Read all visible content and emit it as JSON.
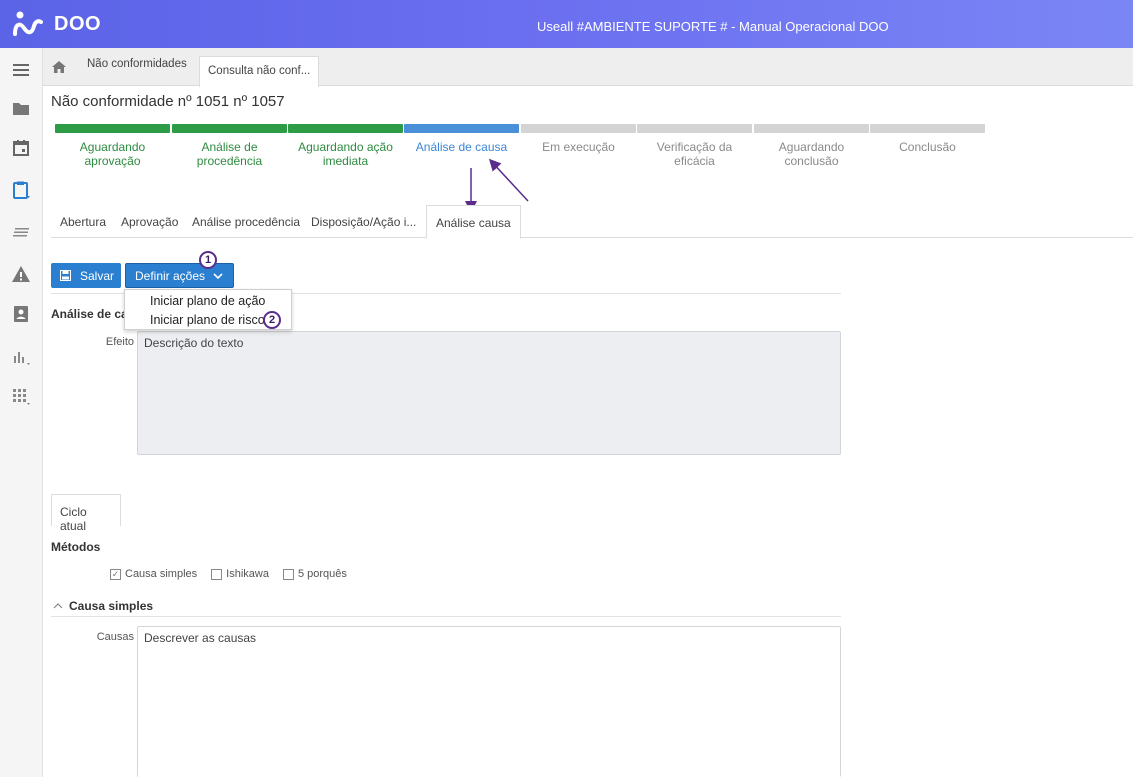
{
  "app": {
    "name": "DOO",
    "window_title": "Useall #AMBIENTE SUPORTE # - Manual Operacional DOO"
  },
  "breadcrumb": {
    "tabs": [
      "Não conformidades",
      "Consulta não conf..."
    ]
  },
  "page": {
    "title": "Não conformidade nº 1051 nº 1057"
  },
  "steps": [
    {
      "label": "Aguardando aprovação",
      "state": "done"
    },
    {
      "label": "Análise de procedência",
      "state": "done"
    },
    {
      "label": "Aguardando ação imediata",
      "state": "done"
    },
    {
      "label": "Análise de causa",
      "state": "current"
    },
    {
      "label": "Em execução",
      "state": "todo"
    },
    {
      "label": "Verificação da eficácia",
      "state": "todo"
    },
    {
      "label": "Aguardando conclusão",
      "state": "todo"
    },
    {
      "label": "Conclusão",
      "state": "todo"
    }
  ],
  "section_tabs": [
    "Abertura",
    "Aprovação",
    "Análise procedência",
    "Disposição/Ação i...",
    "Análise causa"
  ],
  "toolbar": {
    "save_label": "Salvar",
    "define_actions_label": "Definir ações"
  },
  "dropdown": {
    "items": [
      "Iniciar plano de ação",
      "Iniciar plano de risco"
    ]
  },
  "callouts": [
    "1",
    "2"
  ],
  "analysis": {
    "section_label": "Análise de cau",
    "effect_label": "Efeito",
    "effect_value": "Descrição do texto"
  },
  "cycle": {
    "tab_label": "Ciclo atual",
    "methods_label": "Métodos",
    "methods": [
      {
        "label": "Causa simples",
        "checked": true
      },
      {
        "label": "Ishikawa",
        "checked": false
      },
      {
        "label": "5 porquês",
        "checked": false
      }
    ],
    "simple_cause_header": "Causa simples",
    "causes_label": "Causas",
    "causes_value": "Descrever as causas"
  },
  "colors": {
    "header_start": "#5b63e6",
    "done": "#2e9b47",
    "current": "#4a90d9",
    "todo": "#d4d4d4",
    "button": "#2a7fd0",
    "annotation": "#5a2d8c"
  }
}
